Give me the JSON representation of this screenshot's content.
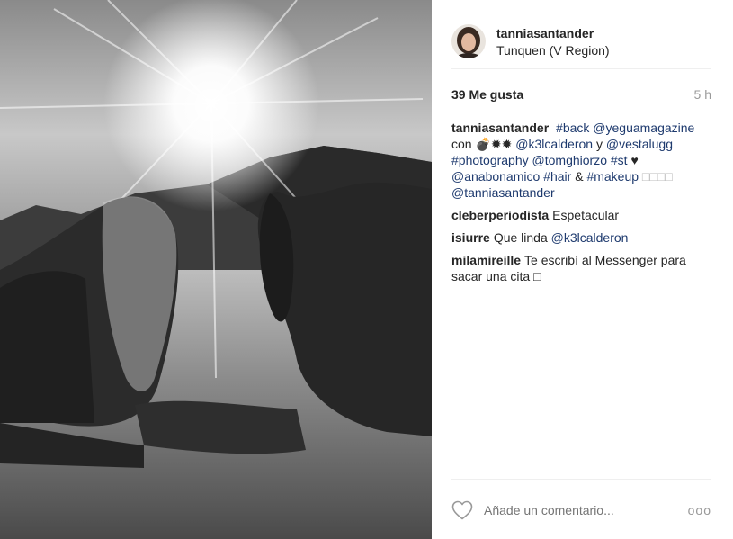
{
  "post": {
    "author": {
      "username": "tanniasantander",
      "location": "Tunquen (V Region)"
    },
    "likes_label": "39 Me gusta",
    "time_label": "5 h",
    "caption": {
      "username": "tanniasantander",
      "t1": "#back",
      "t2": "@yeguamagazine",
      "t3": "con ",
      "t4": "💣✹✹",
      "t5": "@k3lcalderon",
      "t6": " y ",
      "t7": "@vestalugg",
      "t8": "#photography",
      "t9": "@tomghiorzo",
      "t10": "#st",
      "t11": "♥",
      "t12": "@anabonamico",
      "t13": "#hair",
      "t14": " & ",
      "t15": "#makeup",
      "t16": "□□□□",
      "t17": "@tanniasantander"
    },
    "comments": [
      {
        "username": "cleberperiodista",
        "text": "Espetacular"
      },
      {
        "username": "isiurre",
        "text": "Que linda ",
        "mention": "@k3lcalderon"
      },
      {
        "username": "milamireille",
        "text": "Te escribí al Messenger para sacar una cita □"
      }
    ],
    "footer": {
      "comment_placeholder": "Añade un comentario...",
      "more_label": "ooo"
    }
  },
  "icons": {
    "like": "heart-outline-icon",
    "more": "more-options-icon"
  },
  "colors": {
    "link": "#1e3a6e",
    "muted": "#999999",
    "divider": "#efefef"
  }
}
